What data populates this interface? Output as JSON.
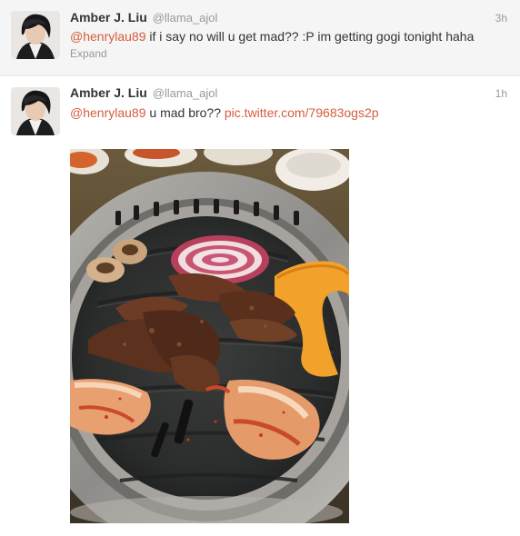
{
  "tweets": [
    {
      "fullname": "Amber J. Liu",
      "username": "@llama_ajol",
      "time": "3h",
      "mention": "@henrylau89",
      "body": " if i say no will u get mad?? :P im getting gogi tonight haha",
      "expand_label": "Expand"
    },
    {
      "fullname": "Amber J. Liu",
      "username": "@llama_ajol",
      "time": "1h",
      "mention": "@henrylau89",
      "body": " u mad bro?? ",
      "link": "pic.twitter.com/79683ogs2p"
    }
  ],
  "colors": {
    "link": "#d45d3c",
    "muted": "#999999",
    "text": "#333333",
    "unread_bg": "#f5f5f5"
  }
}
